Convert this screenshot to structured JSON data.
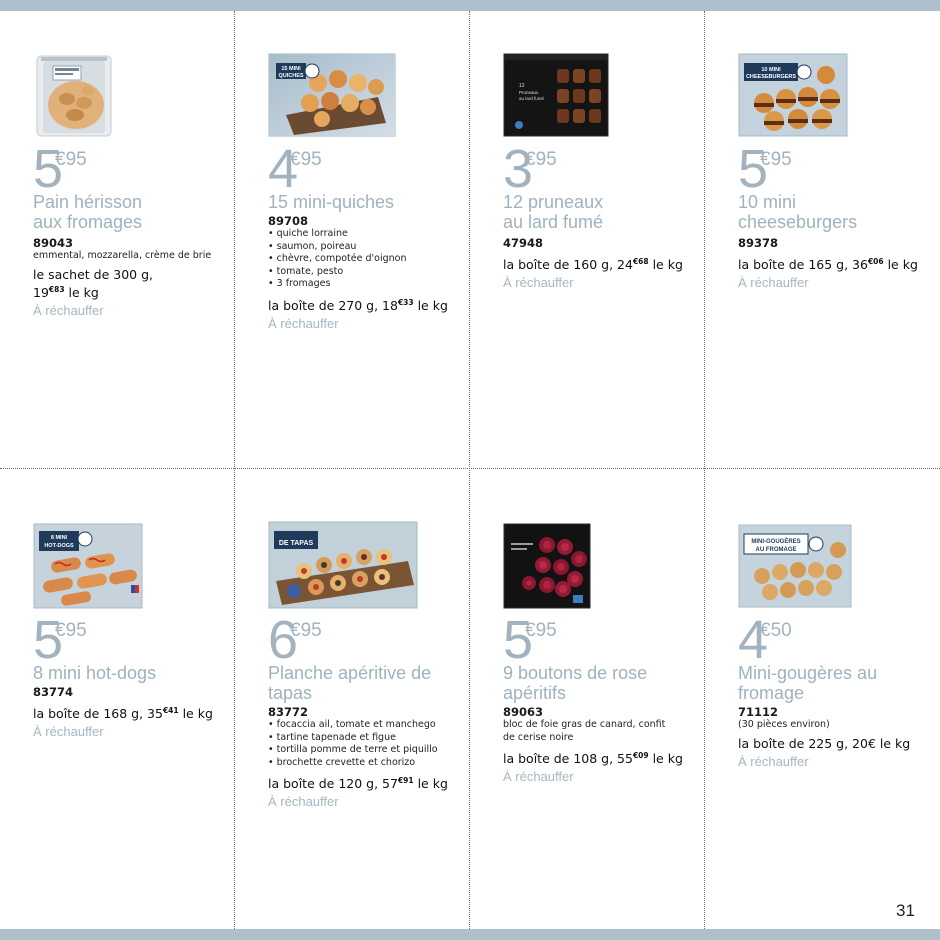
{
  "page_number": "31",
  "accent_color": "#adc0cc",
  "label_color": "#a2b3bf",
  "products": [
    {
      "price_euros": "5",
      "price_cents": "€95",
      "name": [
        "Pain hérisson",
        "aux fromages"
      ],
      "ref": "89043",
      "desc": [
        "emmental, mozzarella, crème de brie"
      ],
      "items": [],
      "pack_main": [
        "le sachet de 300 g,",
        "19"
      ],
      "pack_sup": "€83",
      "pack_end": " le kg",
      "heat": "À réchauffer",
      "icon": "cheese-bread-bag-icon"
    },
    {
      "price_euros": "4",
      "price_cents": "€95",
      "name": [
        "15 mini-quiches"
      ],
      "ref": "89708",
      "box_label": [
        "15 MINI",
        "QUICHES"
      ],
      "desc": [],
      "items": [
        "quiche lorraine",
        "saumon, poireau",
        "chèvre, compotée d'oignon",
        "tomate, pesto",
        "3 fromages"
      ],
      "pack_main": [
        "la boîte de 270 g, 18"
      ],
      "pack_sup": "€33",
      "pack_end": " le kg",
      "heat": "À réchauffer",
      "icon": "quiche-box-icon"
    },
    {
      "price_euros": "3",
      "price_cents": "€95",
      "name": [
        "12 pruneaux",
        "au lard fumé"
      ],
      "ref": "47948",
      "box_label": [
        "12",
        "Pruneaux",
        "au lard fumé"
      ],
      "desc": [],
      "items": [],
      "pack_main": [
        "la boîte de 160 g, 24"
      ],
      "pack_sup": "€68",
      "pack_end": " le kg",
      "heat": "À réchauffer",
      "icon": "prune-box-icon"
    },
    {
      "price_euros": "5",
      "price_cents": "€95",
      "name": [
        "10 mini",
        "cheeseburgers"
      ],
      "ref": "89378",
      "box_label": [
        "10 MINI",
        "CHEESEBURGERS"
      ],
      "desc": [],
      "items": [],
      "pack_main": [
        "la boîte de 165 g, 36"
      ],
      "pack_sup": "€06",
      "pack_end": " le kg",
      "heat": "À réchauffer",
      "icon": "cheeseburger-box-icon"
    },
    {
      "price_euros": "5",
      "price_cents": "€95",
      "name": [
        "8 mini hot-dogs"
      ],
      "ref": "83774",
      "box_label": [
        "8 MINI",
        "HOT-DOGS"
      ],
      "desc": [],
      "items": [],
      "pack_main": [
        "la boîte de 168 g, 35"
      ],
      "pack_sup": "€41",
      "pack_end": " le kg",
      "heat": "À réchauffer",
      "icon": "hotdog-box-icon"
    },
    {
      "price_euros": "6",
      "price_cents": "€95",
      "name": [
        "Planche apéritive de",
        "tapas"
      ],
      "ref": "83772",
      "box_label": [
        "DE TAPAS"
      ],
      "desc": [],
      "items": [
        "focaccia ail, tomate et manchego",
        "tartine tapenade et figue",
        "tortilla pomme de terre et piquillo",
        "brochette crevette et chorizo"
      ],
      "pack_main": [
        "la boîte de 120 g, 57"
      ],
      "pack_sup": "€91",
      "pack_end": " le kg",
      "heat": "À réchauffer",
      "icon": "tapas-box-icon"
    },
    {
      "price_euros": "5",
      "price_cents": "€95",
      "name": [
        "9 boutons de rose",
        "apéritifs"
      ],
      "ref": "89063",
      "desc": [
        "bloc de foie gras de canard, confit",
        "de cerise noire"
      ],
      "items": [],
      "pack_main": [
        "la boîte de 108 g, 55"
      ],
      "pack_sup": "€09",
      "pack_end": " le kg",
      "heat": "À réchauffer",
      "icon": "rose-box-icon"
    },
    {
      "price_euros": "4",
      "price_cents": "€50",
      "name": [
        "Mini-gougères au",
        "fromage"
      ],
      "ref": "71112",
      "box_label": [
        "MINI-GOUGÈRES",
        "AU FROMAGE"
      ],
      "desc": [
        "(30 pièces environ)"
      ],
      "items": [],
      "pack_main": [
        "la boîte de 225 g, 20€ le kg"
      ],
      "pack_sup": "",
      "pack_end": "",
      "heat": "À réchauffer",
      "icon": "gougeres-box-icon"
    }
  ]
}
